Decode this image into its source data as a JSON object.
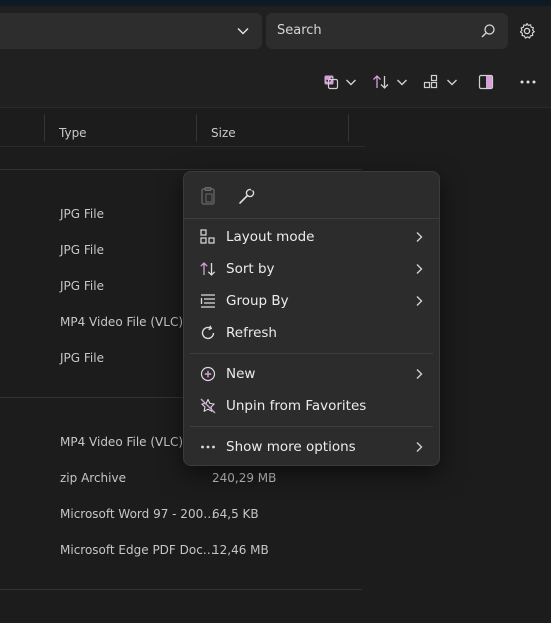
{
  "search": {
    "placeholder": "Search"
  },
  "columns": {
    "type": "Type",
    "size": "Size"
  },
  "rows": [
    {
      "type": "JPG File",
      "size": ""
    },
    {
      "type": "JPG File",
      "size": ""
    },
    {
      "type": "JPG File",
      "size": ""
    },
    {
      "type": "MP4 Video File (VLC)",
      "size": ""
    },
    {
      "type": "JPG File",
      "size": ""
    },
    {
      "type": "MP4 Video File (VLC)",
      "size": ""
    },
    {
      "type": "zip Archive",
      "size": "240,29 MB"
    },
    {
      "type": "Microsoft Word 97 - 200…",
      "size": "64,5 KB"
    },
    {
      "type": "Microsoft Edge PDF Doc…",
      "size": "12,46 MB"
    }
  ],
  "context_menu": {
    "items": [
      {
        "label": "Layout mode",
        "icon": "layout-icon",
        "submenu": true
      },
      {
        "label": "Sort by",
        "icon": "sort-icon",
        "submenu": true
      },
      {
        "label": "Group By",
        "icon": "group-icon",
        "submenu": true
      },
      {
        "label": "Refresh",
        "icon": "refresh-icon",
        "submenu": false
      },
      {
        "label": "New",
        "icon": "new-icon",
        "submenu": true
      },
      {
        "label": "Unpin from Favorites",
        "icon": "unpin-icon",
        "submenu": false
      },
      {
        "label": "Show more options",
        "icon": "more-options-icon",
        "submenu": true
      }
    ]
  },
  "colors": {
    "accent": "#d7a0d8",
    "menu_bg": "#2c2c2c",
    "window_bg": "#1c1c1c"
  }
}
